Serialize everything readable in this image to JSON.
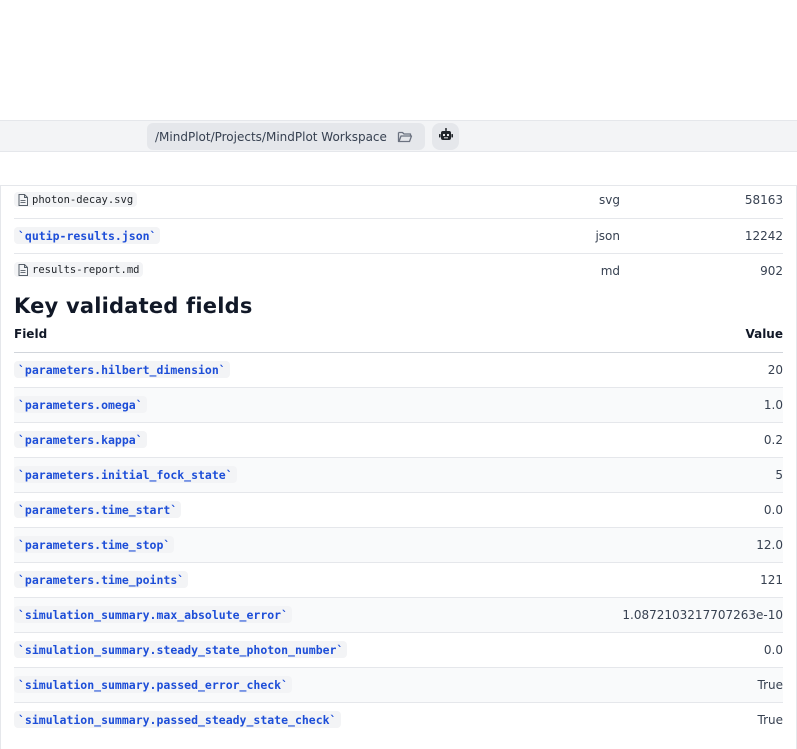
{
  "path_bar": {
    "path": "/MindPlot/Projects/MindPlot Workspace",
    "folder_icon": "folder-open-icon",
    "bot_icon": "robot-icon"
  },
  "files_table": {
    "rows": [
      {
        "name": "photon-decay.svg",
        "style": "file-link",
        "type": "svg",
        "size": "58163"
      },
      {
        "name": "`qutip-results.json`",
        "style": "code",
        "type": "json",
        "size": "12242"
      },
      {
        "name": "results-report.md",
        "style": "file-link",
        "type": "md",
        "size": "902"
      }
    ]
  },
  "key_fields": {
    "title": "Key validated fields",
    "headers": {
      "field": "Field",
      "value": "Value"
    },
    "rows": [
      {
        "field": "`parameters.hilbert_dimension`",
        "value": "20"
      },
      {
        "field": "`parameters.omega`",
        "value": "1.0"
      },
      {
        "field": "`parameters.kappa`",
        "value": "0.2"
      },
      {
        "field": "`parameters.initial_fock_state`",
        "value": "5"
      },
      {
        "field": "`parameters.time_start`",
        "value": "0.0"
      },
      {
        "field": "`parameters.time_stop`",
        "value": "12.0"
      },
      {
        "field": "`parameters.time_points`",
        "value": "121"
      },
      {
        "field": "`simulation_summary.max_absolute_error`",
        "value": "1.0872103217707263e-10"
      },
      {
        "field": "`simulation_summary.steady_state_photon_number`",
        "value": "0.0"
      },
      {
        "field": "`simulation_summary.passed_error_check`",
        "value": "True"
      },
      {
        "field": "`simulation_summary.passed_steady_state_check`",
        "value": "True"
      }
    ]
  },
  "colors": {
    "code_text": "#1d4ed8",
    "code_bg": "#f3f4f6",
    "path_bar_bg": "#f3f4f6"
  }
}
